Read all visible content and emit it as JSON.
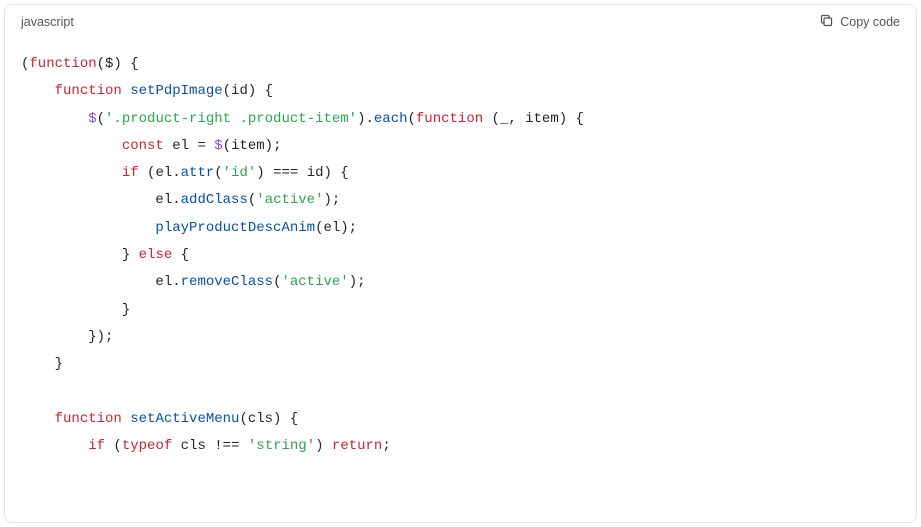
{
  "header": {
    "language": "javascript",
    "copy_label": "Copy code"
  },
  "code": {
    "l1": {
      "a": "(",
      "b": "function",
      "c": "($) {"
    },
    "l2": {
      "a": "function",
      "b": " ",
      "c": "setPdpImage",
      "d": "(id) {"
    },
    "l3": {
      "a": "$",
      "b": "(",
      "c": "'.product-right .product-item'",
      "d": ").",
      "e": "each",
      "f": "(",
      "g": "function",
      "h": " (_, item) {"
    },
    "l4": {
      "a": "const",
      "b": " el = ",
      "c": "$",
      "d": "(item);"
    },
    "l5": {
      "a": "if",
      "b": " (el.",
      "c": "attr",
      "d": "(",
      "e": "'id'",
      "f": ") === id) {"
    },
    "l6": {
      "a": "el.",
      "b": "addClass",
      "c": "(",
      "d": "'active'",
      "e": ");"
    },
    "l7": {
      "a": "playProductDescAnim",
      "b": "(el);"
    },
    "l8": {
      "a": "} ",
      "b": "else",
      "c": " {"
    },
    "l9": {
      "a": "el.",
      "b": "removeClass",
      "c": "(",
      "d": "'active'",
      "e": ");"
    },
    "l10": {
      "a": "}"
    },
    "l11": {
      "a": "});"
    },
    "l12": {
      "a": "}"
    },
    "l13": {
      "a": ""
    },
    "l14": {
      "a": "function",
      "b": " ",
      "c": "setActiveMenu",
      "d": "(cls) {"
    },
    "l15": {
      "a": "if",
      "b": " (",
      "c": "typeof",
      "d": " cls !== ",
      "e": "'string'",
      "f": ") ",
      "g": "return",
      "h": ";"
    }
  },
  "indent": {
    "i1": "    ",
    "i2": "        ",
    "i3": "            ",
    "i4": "                "
  }
}
